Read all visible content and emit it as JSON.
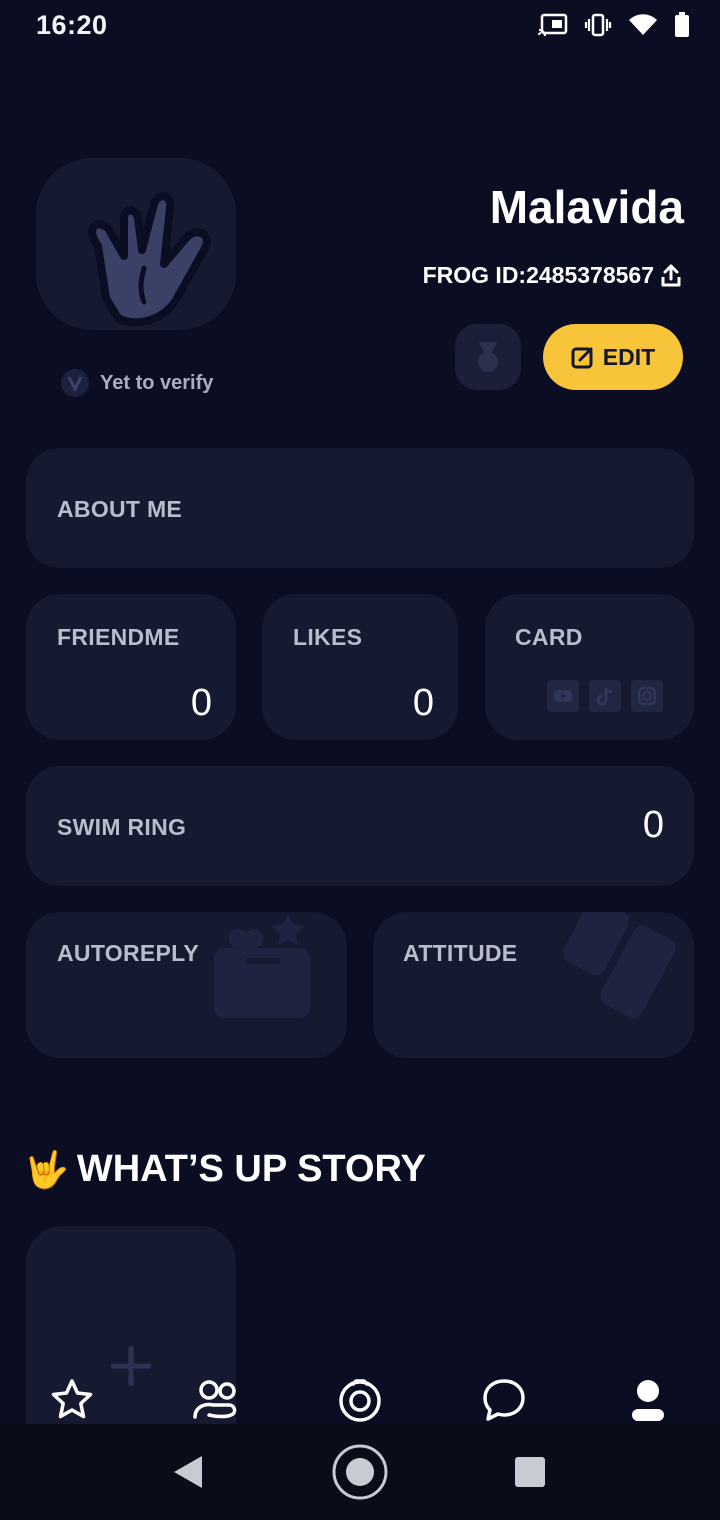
{
  "status_bar": {
    "time": "16:20",
    "icons": [
      "cast-icon",
      "vibrate-icon",
      "wifi-icon",
      "battery-icon"
    ]
  },
  "profile": {
    "name": "Malavida",
    "frog_id": "FROG ID:2485378567",
    "verify_text": "Yet to verify",
    "edit_label": "EDIT"
  },
  "cards": {
    "about_me": {
      "label": "ABOUT ME"
    },
    "friendme": {
      "label": "FRIENDME",
      "value": "0"
    },
    "likes": {
      "label": "LIKES",
      "value": "0"
    },
    "card": {
      "label": "CARD",
      "icons": [
        "youtube-icon",
        "tiktok-icon",
        "instagram-icon"
      ]
    },
    "swim_ring": {
      "label": "SWIM RING",
      "value": "0"
    },
    "autoreply": {
      "label": "AUTOREPLY"
    },
    "attitude": {
      "label": "ATTITUDE"
    }
  },
  "story": {
    "title": "WHAT’S UP STORY",
    "emoji": "🤟"
  },
  "bottom_nav": [
    "star-icon",
    "friends-icon",
    "camera-icon",
    "chat-icon",
    "profile-icon"
  ],
  "colors": {
    "background": "#0b0e22",
    "card": "#161a30",
    "accent": "#f8c43a"
  }
}
